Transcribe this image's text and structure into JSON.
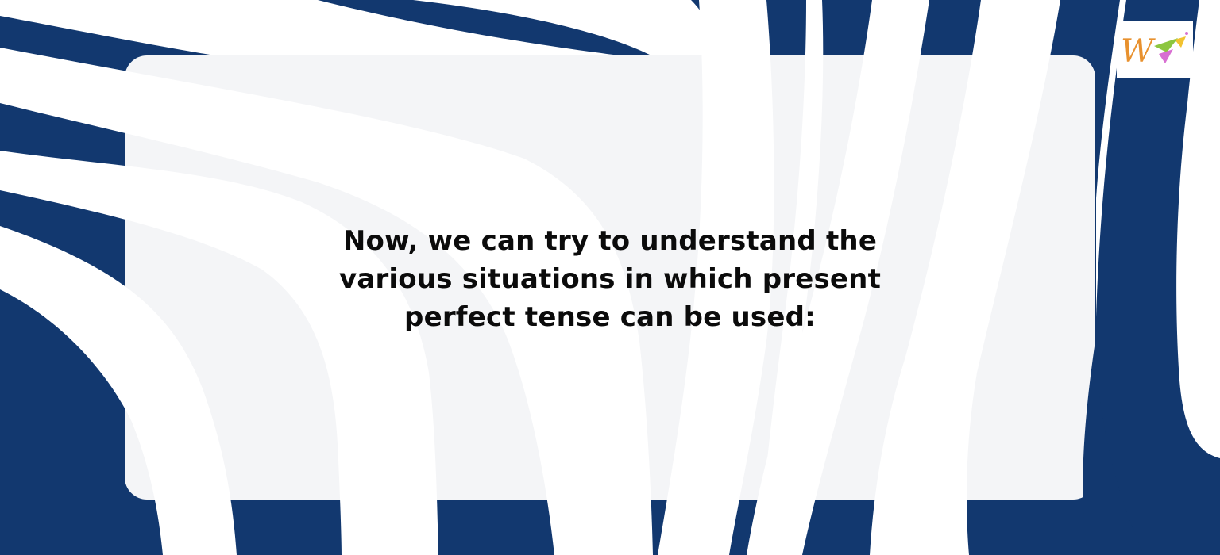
{
  "colors": {
    "navy": "#12386f",
    "panel": "#f4f5f7",
    "white": "#ffffff",
    "text": "#0b0b0b",
    "logo_orange": "#e8912e",
    "logo_pink": "#d86fd2",
    "logo_green": "#8cc63f",
    "logo_yellow": "#f2c230"
  },
  "logo": {
    "name": "brand-logo",
    "letter": "W"
  },
  "message": {
    "text": "Now, we can try to understand the various situations in which present perfect tense can be used:"
  }
}
